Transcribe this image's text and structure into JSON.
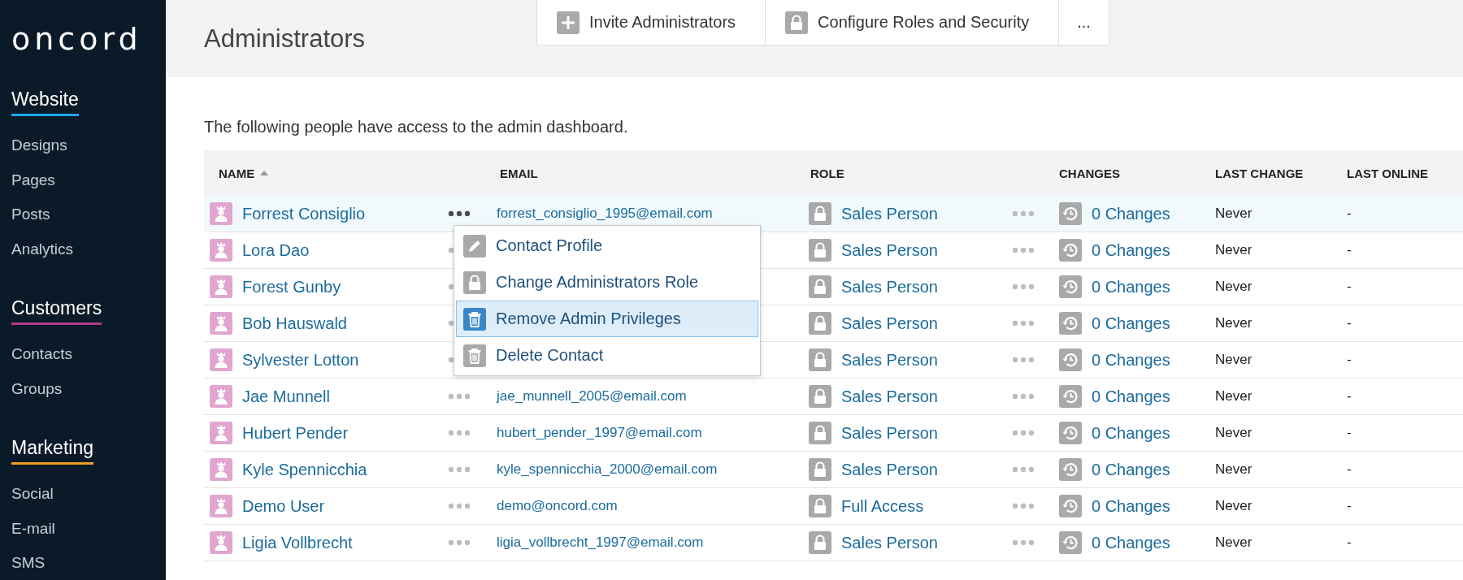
{
  "sidebar": {
    "logo": "oncord",
    "sections": [
      {
        "title": "Website",
        "color": "#1ea7e8",
        "items": [
          "Designs",
          "Pages",
          "Posts",
          "Analytics"
        ]
      },
      {
        "title": "Customers",
        "color": "#b8388e",
        "items": [
          "Contacts",
          "Groups"
        ]
      },
      {
        "title": "Marketing",
        "color": "#f0a020",
        "items": [
          "Social",
          "E-mail",
          "SMS"
        ]
      }
    ]
  },
  "page": {
    "title": "Administrators",
    "description": "The following people have access to the admin dashboard."
  },
  "toolbar": [
    {
      "label": "Invite Administrators",
      "kind": "plus"
    },
    {
      "label": "Configure Roles and Security",
      "kind": "lock"
    },
    {
      "label": "...",
      "kind": "more"
    }
  ],
  "table": {
    "columns": [
      {
        "label": "NAME",
        "sorted": true
      },
      {
        "label": "EMAIL",
        "sorted": false
      },
      {
        "label": "ROLE",
        "sorted": false
      },
      {
        "label": "CHANGES",
        "sorted": false
      },
      {
        "label": "LAST CHANGE",
        "sorted": false
      },
      {
        "label": "LAST ONLINE",
        "sorted": false
      }
    ],
    "rows": [
      {
        "name": "Forrest Consiglio",
        "email": "forrest_consiglio_1995@email.com",
        "role": "Sales Person",
        "changes": "0 Changes",
        "last_change": "Never",
        "last_online": "-",
        "selected": true
      },
      {
        "name": "Lora Dao",
        "role": "Sales Person",
        "changes": "0 Changes",
        "last_change": "Never",
        "last_online": "-",
        "selected": false
      },
      {
        "name": "Forest Gunby",
        "role": "Sales Person",
        "changes": "0 Changes",
        "last_change": "Never",
        "last_online": "-",
        "selected": false
      },
      {
        "name": "Bob Hauswald",
        "role": "Sales Person",
        "changes": "0 Changes",
        "last_change": "Never",
        "last_online": "-",
        "selected": false
      },
      {
        "name": "Sylvester Lotton",
        "role": "Sales Person",
        "changes": "0 Changes",
        "last_change": "Never",
        "last_online": "-",
        "selected": false
      },
      {
        "name": "Jae Munnell",
        "email": "jae_munnell_2005@email.com",
        "role": "Sales Person",
        "changes": "0 Changes",
        "last_change": "Never",
        "last_online": "-",
        "selected": false
      },
      {
        "name": "Hubert Pender",
        "email": "hubert_pender_1997@email.com",
        "role": "Sales Person",
        "changes": "0 Changes",
        "last_change": "Never",
        "last_online": "-",
        "selected": false
      },
      {
        "name": "Kyle Spennicchia",
        "email": "kyle_spennicchia_2000@email.com",
        "role": "Sales Person",
        "changes": "0 Changes",
        "last_change": "Never",
        "last_online": "-",
        "selected": false
      },
      {
        "name": "Demo User",
        "email": "demo@oncord.com",
        "role": "Full Access",
        "changes": "0 Changes",
        "last_change": "Never",
        "last_online": "-",
        "selected": false
      },
      {
        "name": "Ligia Vollbrecht",
        "email": "ligia_vollbrecht_1997@email.com",
        "role": "Sales Person",
        "changes": "0 Changes",
        "last_change": "Never",
        "last_online": "-",
        "selected": false
      }
    ]
  },
  "context_menu": {
    "items": [
      {
        "label": "Contact Profile",
        "kind": "edit",
        "selected": false
      },
      {
        "label": "Change Administrators Role",
        "kind": "lock",
        "selected": false
      },
      {
        "label": "Remove Admin Privileges",
        "kind": "trash",
        "selected": true
      },
      {
        "label": "Delete Contact",
        "kind": "trash",
        "selected": false
      }
    ]
  }
}
